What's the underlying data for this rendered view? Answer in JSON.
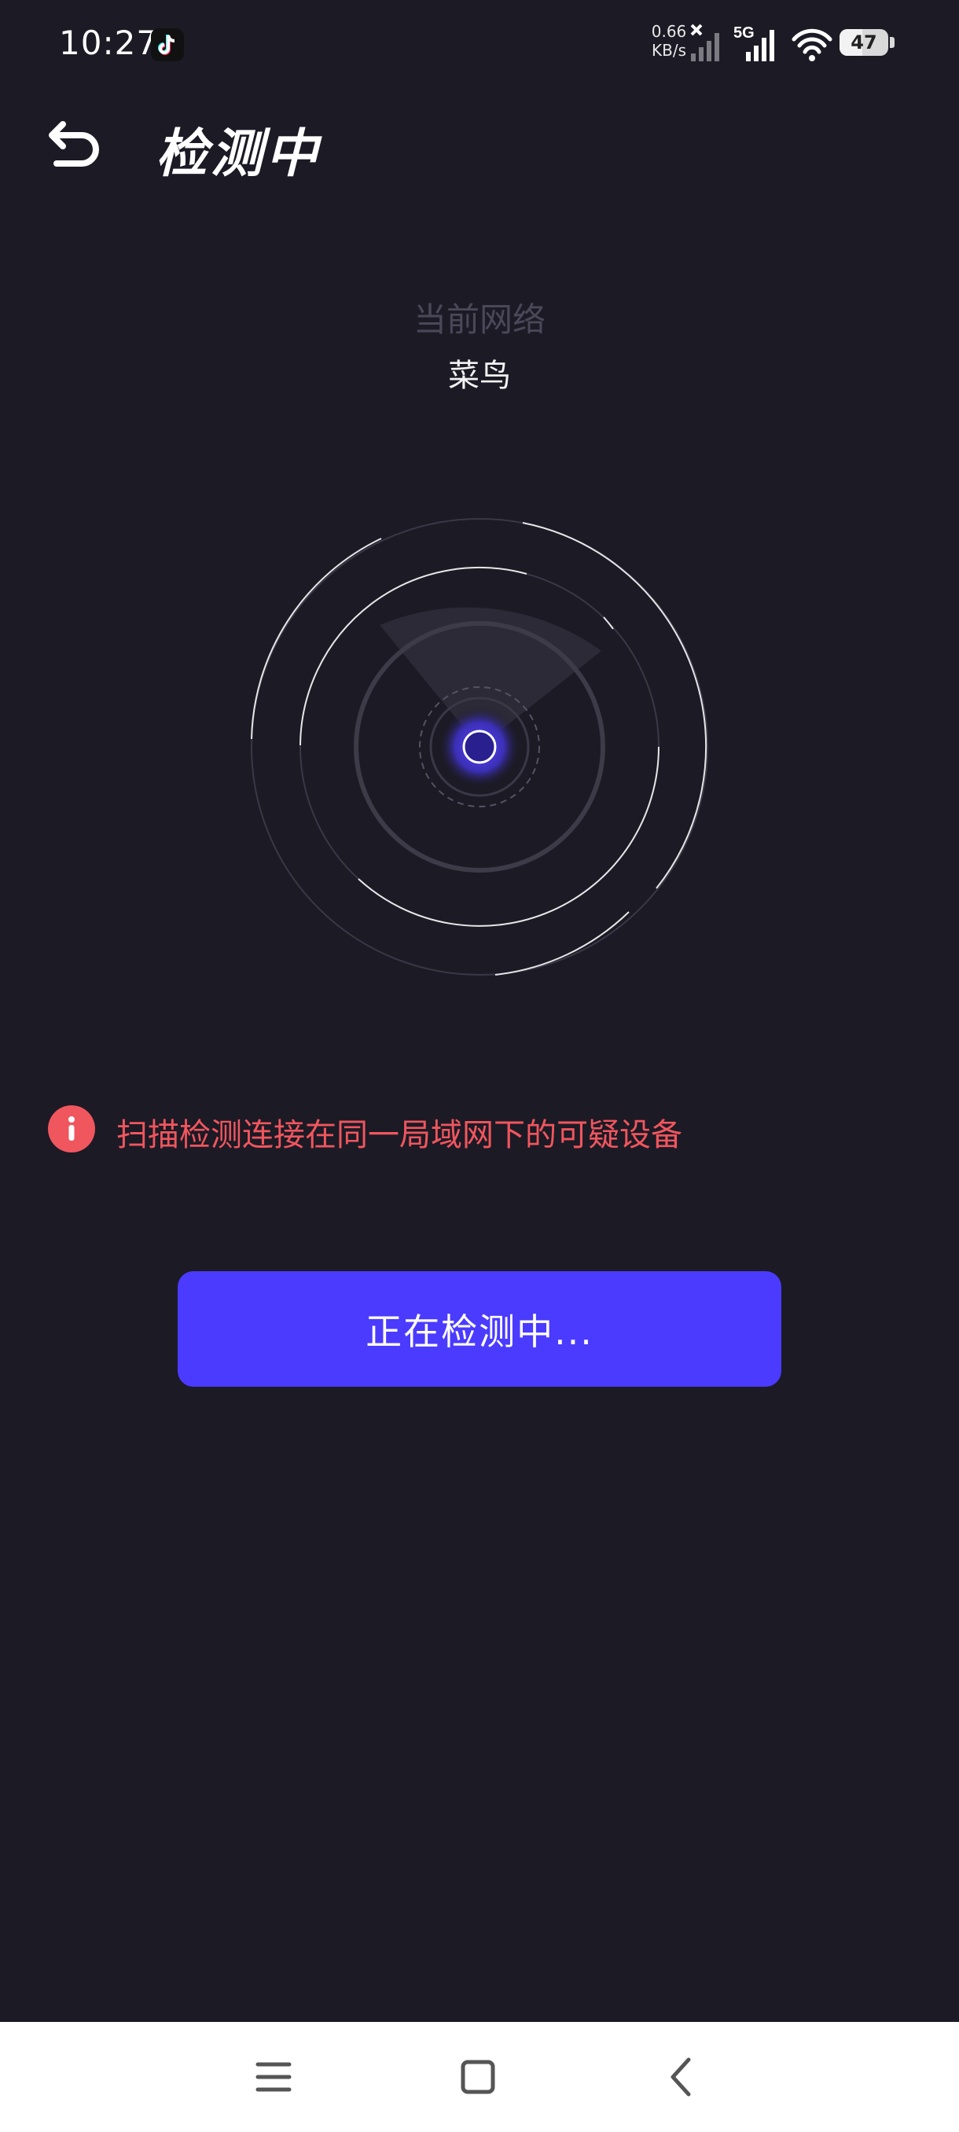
{
  "status_bar": {
    "time": "10:27",
    "speed_value": "0.66",
    "speed_unit": "KB/s",
    "network_type": "5G",
    "battery": "47",
    "battery_level": 0.47
  },
  "header": {
    "title": "检测中",
    "back_icon": "undo-arrow-icon"
  },
  "network": {
    "label": "当前网络",
    "name": "菜鸟"
  },
  "warning": {
    "icon": "info-icon",
    "text": "扫描检测连接在同一局域网下的可疑设备"
  },
  "action": {
    "button_label": "正在检测中..."
  },
  "nav": {
    "menu_icon": "menu-icon",
    "home_icon": "home-square-icon",
    "back_icon": "chevron-left-icon"
  },
  "colors": {
    "background": "#1c1a25",
    "accent": "#4a3bff",
    "warning": "#f0565e"
  }
}
